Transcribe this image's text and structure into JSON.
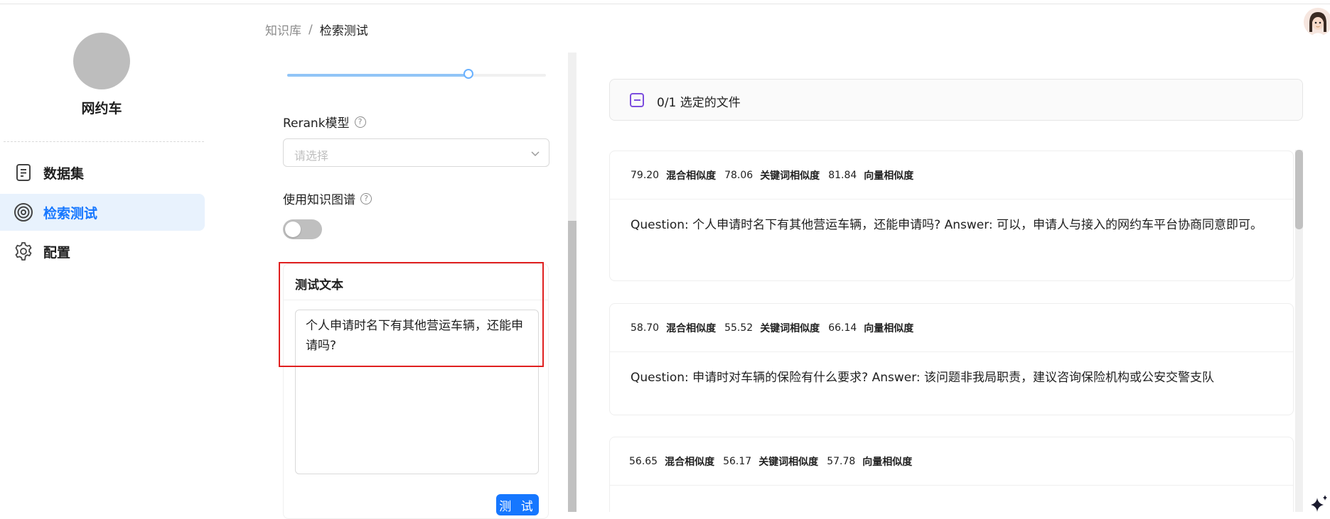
{
  "sidebar": {
    "kb_name": "网约车",
    "items": [
      {
        "label": "数据集",
        "icon": "document-icon",
        "active": false
      },
      {
        "label": "检索测试",
        "icon": "target-icon",
        "active": true
      },
      {
        "label": "配置",
        "icon": "gear-icon",
        "active": false
      }
    ]
  },
  "breadcrumb": {
    "root": "知识库",
    "separator": "/",
    "current": "检索测试"
  },
  "settings": {
    "similarity_slider": {
      "value_fraction": 0.7
    },
    "rerank_label": "Rerank模型",
    "rerank_placeholder": "请选择",
    "knowledge_graph_label": "使用知识图谱",
    "knowledge_graph_enabled": false,
    "test_text_title": "测试文本",
    "test_text_value": "个人申请时名下有其他营运车辆，还能申请吗?",
    "test_button_label": "测 试"
  },
  "results": {
    "file_selection": "0/1  选定的文件",
    "hybrid_label": "混合相似度",
    "keyword_label": "关键词相似度",
    "vector_label": "向量相似度",
    "items": [
      {
        "hybrid": "79.20",
        "keyword": "78.06",
        "vector": "81.84",
        "content": "Question: 个人申请时名下有其他营运车辆，还能申请吗?  Answer: 可以，申请人与接入的网约车平台协商同意即可。"
      },
      {
        "hybrid": "58.70",
        "keyword": "55.52",
        "vector": "66.14",
        "content": "Question: 申请时对车辆的保险有什么要求?  Answer: 该问题非我局职责，建议咨询保险机构或公安交警支队"
      },
      {
        "hybrid": "56.65",
        "keyword": "56.17",
        "vector": "57.78",
        "content": ""
      }
    ]
  },
  "colors": {
    "accent": "#1677ff",
    "active_nav_bg": "#e8f2fd",
    "highlight": "#e02020",
    "checkbox": "#7c4dde"
  }
}
